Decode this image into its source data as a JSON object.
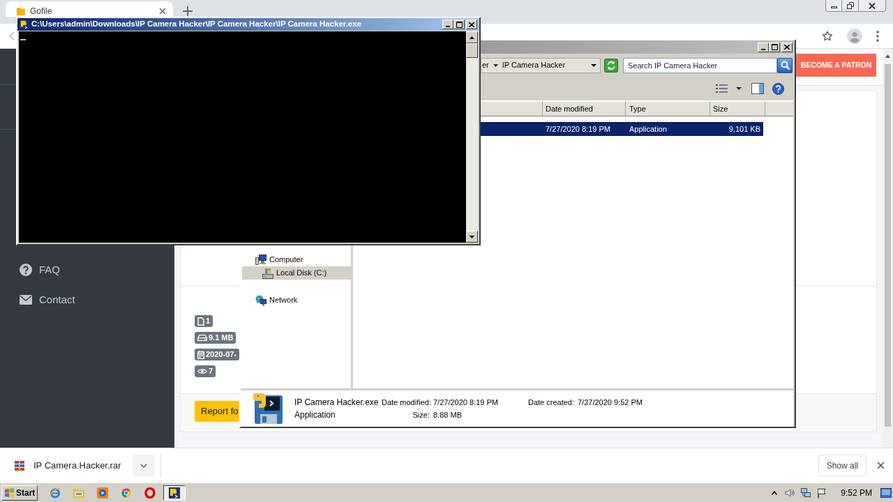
{
  "browser": {
    "tabs": [
      {
        "title": "Gofile",
        "selected": true
      }
    ],
    "sidebar": [
      {
        "kind": "help",
        "label": "FAQ"
      },
      {
        "kind": "mail",
        "label": "Contact"
      }
    ],
    "patron_button": "BECOME A PATRON",
    "stats": [
      {
        "kind": "files",
        "value": "1"
      },
      {
        "kind": "size",
        "value": "9.1 MB"
      },
      {
        "kind": "date",
        "value": "2020-07-"
      },
      {
        "kind": "views",
        "value": "7"
      }
    ],
    "report_button": "Report fo",
    "download": {
      "file": "IP Camera Hacker.rar",
      "show_all": "Show all"
    }
  },
  "console": {
    "title": "C:\\Users\\admin\\Downloads\\IP Camera Hacker\\IP Camera Hacker\\IP Camera Hacker.exe",
    "active": true
  },
  "explorer": {
    "active": false,
    "breadcrumbs": [
      "er",
      "IP Camera Hacker"
    ],
    "search": {
      "placeholder": "Search IP Camera Hacker"
    },
    "columns": [
      "Date modified",
      "Type",
      "Size"
    ],
    "rows": [
      {
        "cells": [
          "7/27/2020 8:19 PM",
          "Application",
          "9,101 KB"
        ],
        "selected": true
      }
    ],
    "nav": [
      {
        "kind": "computer",
        "label": "Computer",
        "selected": false,
        "children": [
          {
            "kind": "drive",
            "label": "Local Disk (C:)",
            "selected": true
          }
        ]
      },
      {
        "kind": "network",
        "label": "Network",
        "selected": false
      }
    ],
    "details": {
      "name": "IP Camera Hacker.exe",
      "type": "Application",
      "fields": [
        {
          "label": "Date modified:",
          "value": "7/27/2020 8:19 PM"
        },
        {
          "label": "Date created:",
          "value": "7/27/2020 9:52 PM"
        },
        {
          "label": "Size:",
          "value": "8.88 MB"
        }
      ]
    }
  },
  "taskbar": {
    "start": "Start",
    "tasks": [
      {
        "selected": true
      }
    ],
    "clock": "9:52 PM"
  }
}
